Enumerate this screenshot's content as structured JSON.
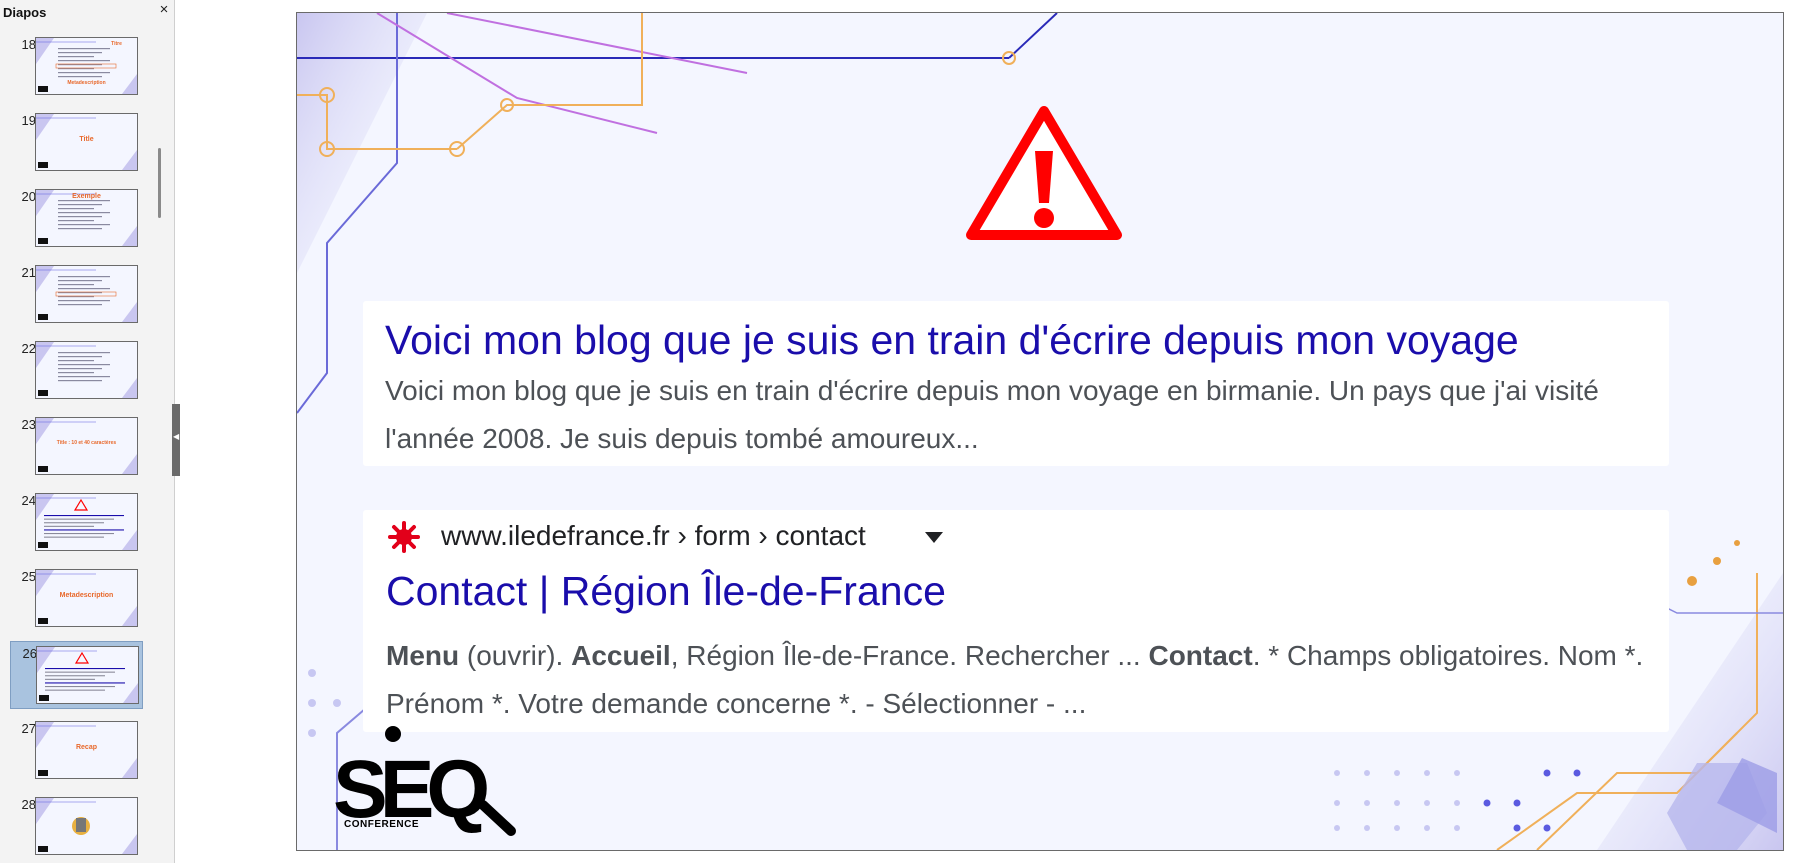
{
  "panel": {
    "title": "Diapos",
    "close_label": "×"
  },
  "slides": [
    {
      "number": "18",
      "kind": "screen",
      "accent_text": "Titre",
      "caption": "Metadescription"
    },
    {
      "number": "19",
      "kind": "title",
      "caption": "Title"
    },
    {
      "number": "20",
      "kind": "list",
      "caption": "Exemple"
    },
    {
      "number": "21",
      "kind": "screen",
      "caption": ""
    },
    {
      "number": "22",
      "kind": "list",
      "caption": ""
    },
    {
      "number": "23",
      "kind": "title",
      "caption": "Title : 10 et 40 caractères"
    },
    {
      "number": "24",
      "kind": "warning",
      "caption": ""
    },
    {
      "number": "25",
      "kind": "title",
      "caption": "Metadescription"
    },
    {
      "number": "26",
      "kind": "warning",
      "caption": "",
      "selected": true
    },
    {
      "number": "27",
      "kind": "title",
      "caption": "Recap"
    },
    {
      "number": "28",
      "kind": "image",
      "caption": ""
    }
  ],
  "slide": {
    "card1": {
      "title": "Voici mon blog que je suis en train d'écrire depuis mon voyage",
      "description": "Voici mon blog que je suis en train d'écrire depuis mon voyage en birmanie. Un pays que j'ai visité l'année 2008. Je suis depuis tombé amoureux..."
    },
    "card2": {
      "url": "www.iledefrance.fr › form › contact",
      "title": "Contact | Région Île-de-France",
      "desc_b1": "Menu",
      "desc_t1": " (ouvrir). ",
      "desc_b2": "Accueil",
      "desc_t2": ", Région Île-de-France. Rechercher ... ",
      "desc_b3": "Contact",
      "desc_t3": ". * Champs obligatoires. Nom *. Prénom *. Votre demande concerne *. - Sélectionner - ..."
    },
    "logo": {
      "text": "SEQ",
      "subtext": "CONFERENCE"
    }
  },
  "colors": {
    "link_blue": "#1a0dab",
    "desc_gray": "#4d5156",
    "warning_red": "#ff0000",
    "accent_orange": "#e8692c",
    "selection": "#a9c3df"
  }
}
